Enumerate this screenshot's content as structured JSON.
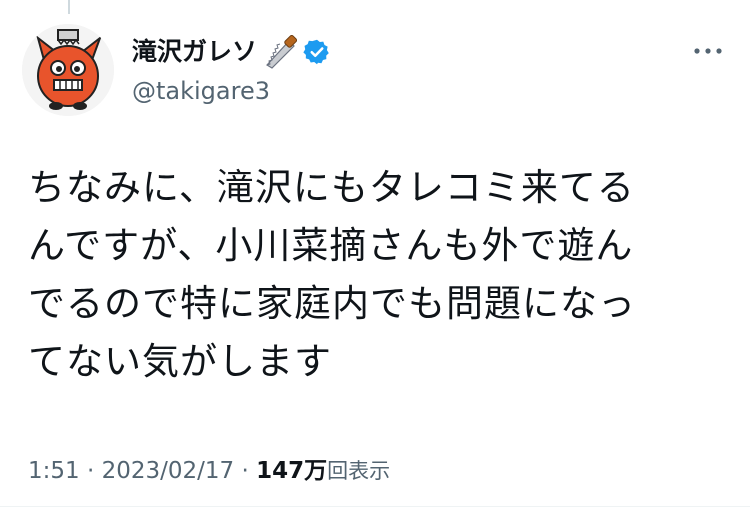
{
  "author": {
    "display_name": "滝沢ガレソ",
    "handle": "@takigare3",
    "name_emoji": "saw-icon",
    "verified_icon": "verified-badge-icon",
    "verified_color": "#1d9bf0"
  },
  "more_icon": "more-horizontal-icon",
  "tweet": {
    "text": "ちなみに、滝沢にもタレコミ来てる\nんですが、小川菜摘さんも外で遊ん\nでるので特に家庭内でも問題になっ\nてない気がします"
  },
  "meta": {
    "time": "1:51",
    "separator": " · ",
    "date": "2023/02/17",
    "separator2": " · ",
    "views_count": "147万",
    "views_label": "回表示"
  },
  "colors": {
    "text": "#0f1419",
    "secondary": "#536471",
    "accent": "#1d9bf0",
    "avatar_character": "#e8542c"
  }
}
